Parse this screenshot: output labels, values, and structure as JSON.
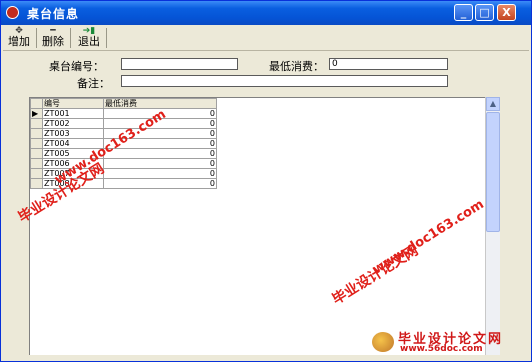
{
  "window": {
    "title": "桌台信息",
    "buttons": {
      "minimize": "_",
      "maximize": "□",
      "close": "X"
    }
  },
  "toolbar": {
    "add_label": "增加",
    "delete_label": "删除",
    "exit_label": "退出"
  },
  "form": {
    "table_no_label": "桌台编号：",
    "table_no_value": "",
    "min_spend_label": "最低消费：",
    "min_spend_value": "0",
    "remark_label": "备注：",
    "remark_value": ""
  },
  "grid": {
    "headers": [
      "编号",
      "最低消费"
    ],
    "rows": [
      {
        "id": "ZT001",
        "min": "0"
      },
      {
        "id": "ZT002",
        "min": "0"
      },
      {
        "id": "ZT003",
        "min": "0"
      },
      {
        "id": "ZT004",
        "min": "0"
      },
      {
        "id": "ZT005",
        "min": "0"
      },
      {
        "id": "ZT006",
        "min": "0"
      },
      {
        "id": "ZT007",
        "min": "0"
      },
      {
        "id": "ZT008",
        "min": "0"
      }
    ]
  },
  "watermarks": {
    "site_cn": "毕业设计论文网",
    "site_url": "www.doc163.com",
    "logo_cn": "毕业设计论文网",
    "logo_url": "www.56doc.com"
  }
}
